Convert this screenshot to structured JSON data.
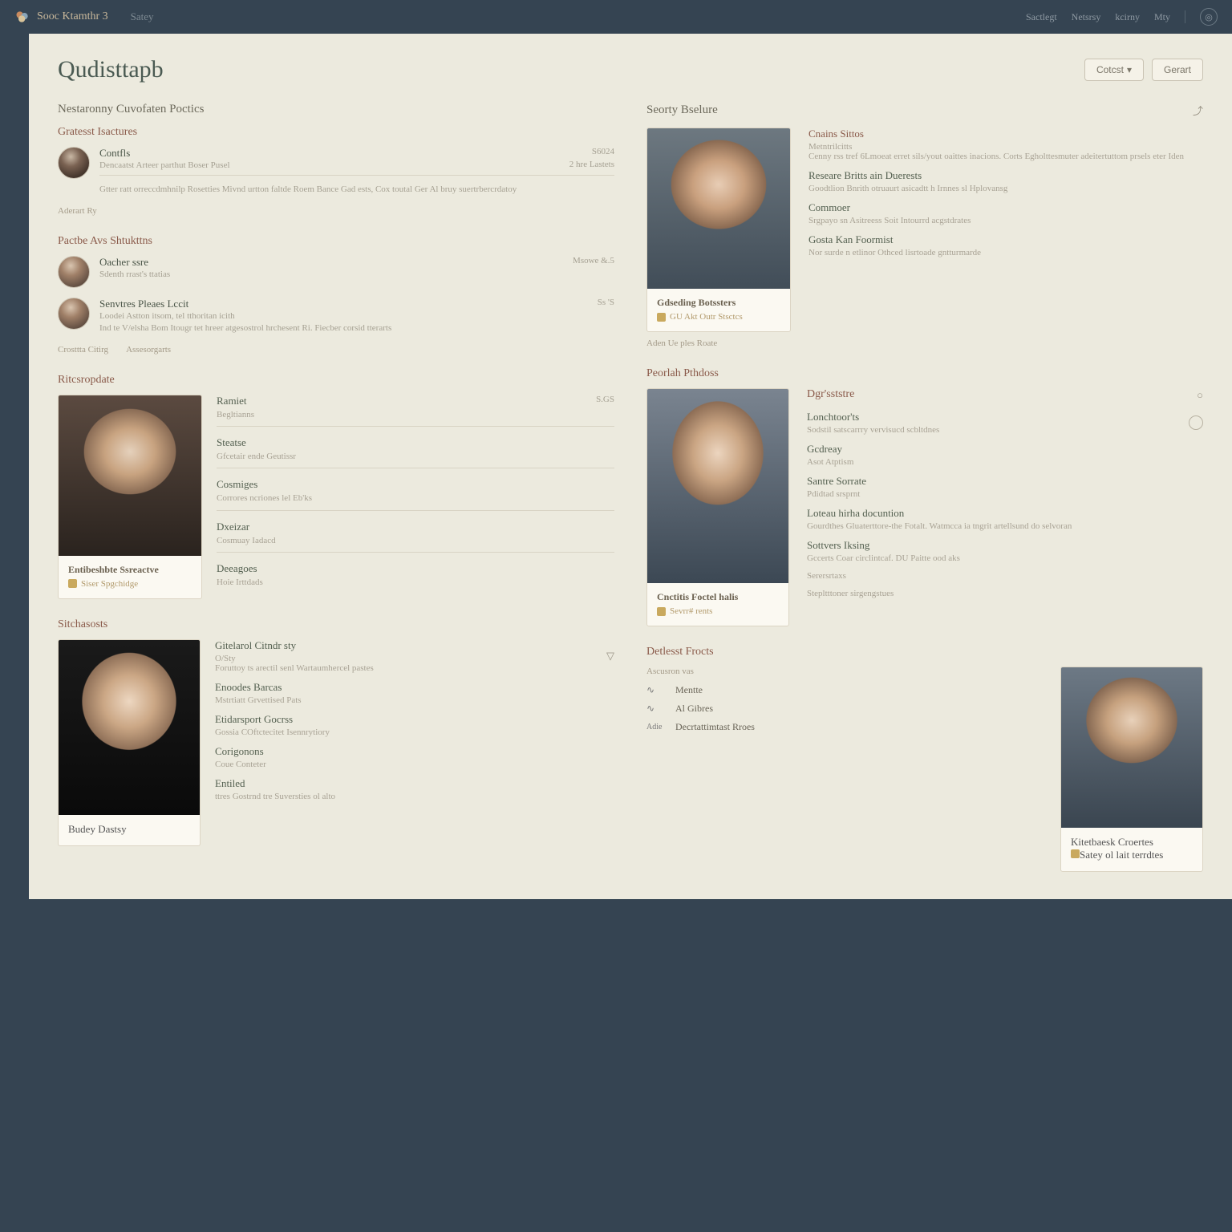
{
  "topbar": {
    "brand": "Sooc Ktamthr 3",
    "subnav": "Satey",
    "links": [
      "Sactlegt",
      "Netsrsy",
      "kcirny",
      "Mty"
    ]
  },
  "page": {
    "title": "Qudisttapb"
  },
  "buttons": {
    "primary": "Cotcst",
    "secondary": "Gerart"
  },
  "left": {
    "sect1": {
      "title": "Nestaronny Cuvofaten Poctics",
      "sub": "Gratesst Isactures",
      "rows": [
        {
          "title": "Contfls",
          "sub1": "Dencaatst Arteer parthut Boser Pusel",
          "sub2": "Gtter ratt orreccdmhnilp Rosetties Mivnd urtton faltde Roem Bance Gad ests, Cox toutal Ger Al bruy suertrbercrdatoy",
          "metric1": "S6024",
          "metric2": "2 hre Lastets"
        }
      ],
      "caption": "Aderart Ry"
    },
    "sect2": {
      "title": "Pactbe Avs Shtukttns",
      "rows": [
        {
          "title": "Oacher ssre",
          "sub": "Sdenth rrast's ttatias",
          "metric": "Msowe &.5"
        },
        {
          "title": "Senvtres Pleaes Lccit",
          "sub1": "Loodei Astton itsom, tel tthoritan icith",
          "sub2": "Ind te V/elsha Bom Itougr tet hreer atgesostrol hrchesent Ri. Fiecber corsid tterarts",
          "metric": "Ss 'S"
        }
      ],
      "caption1": "Crosttta Citirg",
      "caption2": "Assesorgarts"
    },
    "sect3": {
      "title": "Ritcsropdate",
      "card": {
        "name": "Entibeshbte Ssreactve",
        "line2": "Siser Spgchidge"
      },
      "defs": [
        {
          "k": "Ramiet",
          "v": "Begltianns",
          "metric": "S.GS"
        },
        {
          "k": "Steatse",
          "v": "Gfcetair ende Geutissr"
        },
        {
          "k": "Cosmiges",
          "v": "Corrores ncriones lel Eb'ks"
        },
        {
          "k": "Dxeizar",
          "v": "Cosmuay Iadacd"
        },
        {
          "k": "Deeagoes",
          "v": "Hoie Irttdads"
        }
      ]
    },
    "sect4": {
      "title": "Sitchasosts",
      "card": {
        "name": "Budey Dastsy"
      },
      "items": [
        {
          "k": "Gitelarol Citndr sty",
          "v": "O/Sty",
          "v2": "Foruttoy ts arectil senl Wartaumhercel pastes"
        },
        {
          "k": "Enoodes Barcas",
          "v": "Mstrtiatt Grvettised Pats"
        },
        {
          "k": "Etidarsport Gocrss",
          "v": "Gossia COftctecitet Isennrytiory"
        },
        {
          "k": "Corigonons",
          "v": "Coue Conteter"
        },
        {
          "k": "Entiled",
          "v": "ttres Gostrnd tre Suversties ol alto"
        }
      ]
    }
  },
  "right": {
    "sect1": {
      "title": "Seorty Bselure",
      "card": {
        "name": "Gdseding Botssters",
        "line2": "GU Akt Outr Stsctcs"
      },
      "caption": "Aden Ue ples Roate",
      "items": [
        {
          "k": "Cnains Sittos",
          "v": "Metntrilcitts",
          "v2": "Cenny rss tref 6Lmoeat erret sils/yout oaittes inacions. Corts Egholttesmuter adeitertuttom prsels eter Iden"
        },
        {
          "k": "Researe Britts ain Duerests",
          "v": "Goodtlion Bnrith otruaurt asicadtt h Irnnes sl Hplovansg"
        },
        {
          "k": "Commoer",
          "v": "Srgpayo sn Asitreess Soit Intourrd acgstdrates"
        },
        {
          "k": "Gosta Kan Foormist",
          "v": "Nor surde n etlinor Othced lisrtoade gntturmarde"
        }
      ]
    },
    "sect2": {
      "title": "Peorlah Pthdoss",
      "card": {
        "name": "Cnctitis Foctel halis",
        "line2": "Sevrr# rents"
      },
      "side_title": "Dgr'sststre",
      "items": [
        {
          "k": "Lonchtoor'ts",
          "v": "Sodstil satscarrry vervisucd scbltdnes"
        },
        {
          "k": "Gcdreay",
          "v": "Asot Atptism"
        },
        {
          "k": "Santre Sorrate",
          "v": "Pdidtad srsprnt"
        },
        {
          "k": "Loteau hirha docuntion",
          "v": "Gourdthes Gluaterttore-the Fotalt. Watmcca ia tngrit artellsund do selvoran"
        },
        {
          "k": "Sottvers Iksing",
          "v": "Gccerts Coar circlintcaf. DU Paitte ood aks"
        },
        {
          "k": "Serersrtaxs",
          "v": ""
        },
        {
          "k": "Stepltttoner sirgengstues",
          "v": ""
        }
      ]
    },
    "sect3": {
      "title": "Detlesst Frocts",
      "sub": "Ascusron vas",
      "card": {
        "name": "Kitetbaesk Croertes",
        "line2": "Satey ol lait terrdtes"
      },
      "rows": [
        {
          "ico": "∿",
          "label": "Mentte"
        },
        {
          "ico": "∿",
          "label": "Al Gibres"
        },
        {
          "ico": "Adie",
          "label": "Decrtattimtast Rroes"
        }
      ]
    }
  }
}
